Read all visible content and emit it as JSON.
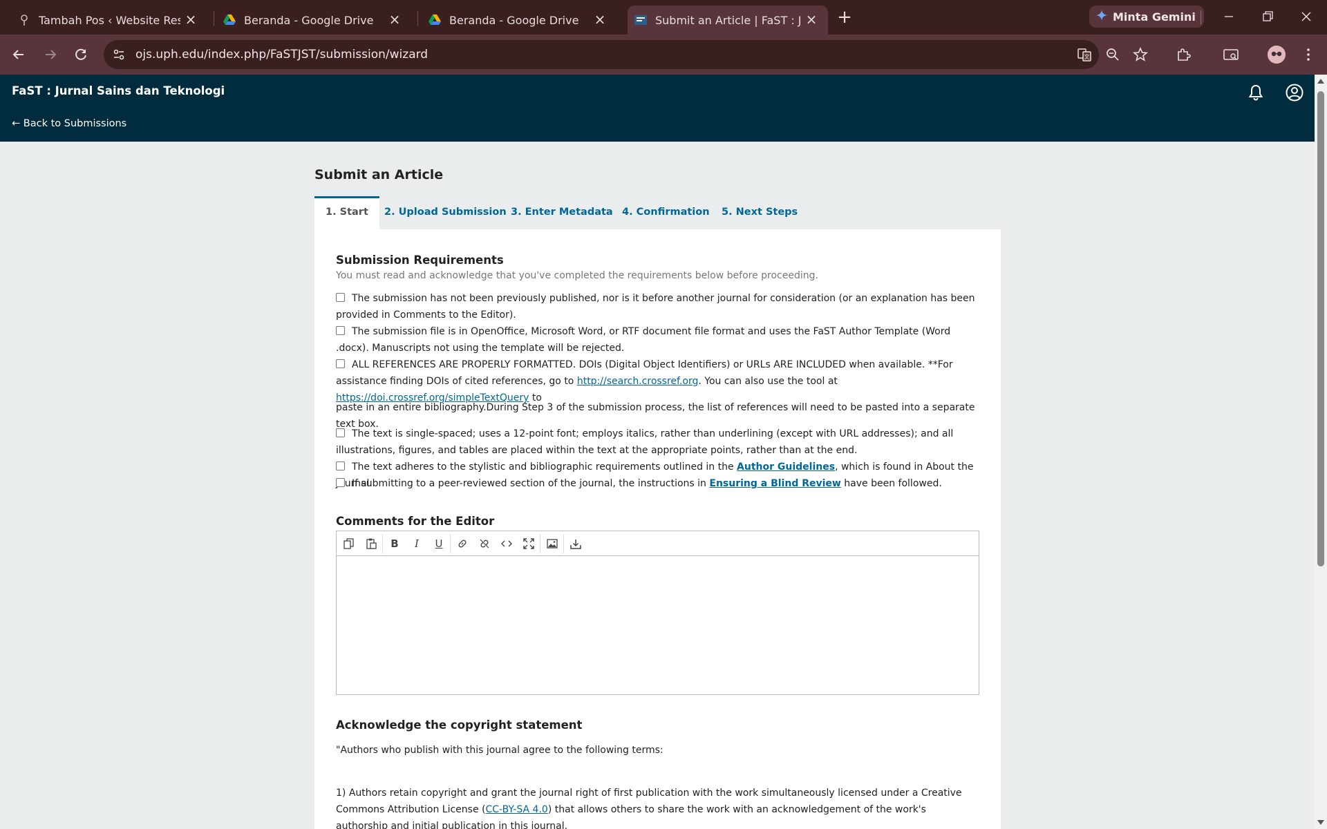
{
  "browser": {
    "tabs": [
      {
        "label": "Tambah Pos ‹ Website Resmi PT",
        "icon": "pin-icon"
      },
      {
        "label": "Beranda - Google Drive",
        "icon": "google-drive-icon"
      },
      {
        "label": "Beranda - Google Drive",
        "icon": "google-drive-icon"
      },
      {
        "label": "Submit an Article | FaST : Jurnal",
        "icon": "ojs-icon",
        "active": true
      }
    ],
    "gemini_label": "Minta Gemini",
    "url": "ojs.uph.edu/index.php/FaSTJST/submission/wizard"
  },
  "header": {
    "site_title": "FaST : Jurnal Sains dan Teknologi",
    "back_link": "← Back to Submissions"
  },
  "page": {
    "title": "Submit an Article",
    "steps": [
      "1. Start",
      "2. Upload Submission",
      "3. Enter Metadata",
      "4. Confirmation",
      "5. Next Steps"
    ],
    "requirements_heading": "Submission Requirements",
    "requirements_intro": "You must read and acknowledge that you've completed the requirements below before proceeding.",
    "requirements": {
      "r1": "The submission has not been previously published, nor is it before another journal for consideration (or an explanation has been provided in Comments to the Editor).",
      "r2": "The submission file is in OpenOffice, Microsoft Word, or RTF document file format and uses the FaST Author Template (Word .docx). Manuscripts not using the template will be rejected.",
      "r3_a": "ALL REFERENCES ARE PROPERLY FORMATTED. DOIs (Digital Object Identifiers) or URLs ARE INCLUDED when available. **For assistance finding DOIs of cited references, go to ",
      "r3_link1": "http://search.crossref.org",
      "r3_b": ". You can also use the tool at ",
      "r3_link2": "https://doi.crossref.org/simpleTextQuery",
      "r3_c": " to",
      "r3_d": "paste in an entire bibliography.During Step 3 of the submission process, the list of references will need to be pasted into a separate text box.",
      "r4": "The text is single-spaced; uses a 12-point font; employs italics, rather than underlining (except with URL addresses); and all illustrations, figures, and tables are placed within the text at the appropriate points, rather than at the end.",
      "r5_a": "The text adheres to the stylistic and bibliographic requirements outlined in the ",
      "r5_link": "Author Guidelines",
      "r5_b": ", which is found in About the Journal.",
      "r6_a": "If submitting to a peer-reviewed section of the journal, the instructions in ",
      "r6_link": "Ensuring a Blind Review",
      "r6_b": " have been followed."
    },
    "comments_heading": "Comments for the Editor",
    "editor_tools": [
      "copy-icon",
      "paste-icon",
      "bold-icon",
      "italic-icon",
      "underline-icon",
      "link-icon",
      "unlink-icon",
      "code-icon",
      "fullscreen-icon",
      "image-icon",
      "upload-icon"
    ],
    "copyright_heading": "Acknowledge the copyright statement",
    "copyright_p1": "\"Authors who publish with this journal agree to the following terms:",
    "copyright_p2_a": "1) Authors retain copyright and grant the journal right of first publication with the work simultaneously licensed under a Creative Commons Attribution License (",
    "copyright_p2_link": "CC-BY-SA 4.0",
    "copyright_p2_b": ") that allows others to share the work with an acknowledgement of the work's authorship and initial publication in this journal."
  }
}
